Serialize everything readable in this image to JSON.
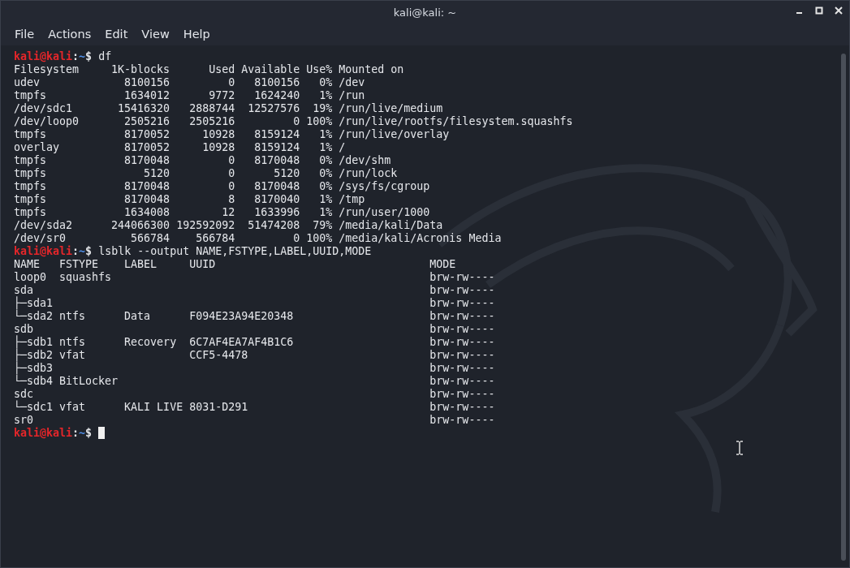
{
  "window": {
    "title": "kali@kali: ~"
  },
  "menu": [
    "File",
    "Actions",
    "Edit",
    "View",
    "Help"
  ],
  "terminal": {
    "lines": [
      {
        "kind": "prompt",
        "user": "kali@kali",
        "separator": ":",
        "path": "~",
        "symbol": "$",
        "command": "df",
        "cursor": false
      },
      {
        "kind": "output",
        "text": "Filesystem     1K-blocks      Used Available Use% Mounted on"
      },
      {
        "kind": "output",
        "text": "udev             8100156         0   8100156   0% /dev"
      },
      {
        "kind": "output",
        "text": "tmpfs            1634012      9772   1624240   1% /run"
      },
      {
        "kind": "output",
        "text": "/dev/sdc1       15416320   2888744  12527576  19% /run/live/medium"
      },
      {
        "kind": "output",
        "text": "/dev/loop0       2505216   2505216         0 100% /run/live/rootfs/filesystem.squashfs"
      },
      {
        "kind": "output",
        "text": "tmpfs            8170052     10928   8159124   1% /run/live/overlay"
      },
      {
        "kind": "output",
        "text": "overlay          8170052     10928   8159124   1% /"
      },
      {
        "kind": "output",
        "text": "tmpfs            8170048         0   8170048   0% /dev/shm"
      },
      {
        "kind": "output",
        "text": "tmpfs               5120         0      5120   0% /run/lock"
      },
      {
        "kind": "output",
        "text": "tmpfs            8170048         0   8170048   0% /sys/fs/cgroup"
      },
      {
        "kind": "output",
        "text": "tmpfs            8170048         8   8170040   1% /tmp"
      },
      {
        "kind": "output",
        "text": "tmpfs            1634008        12   1633996   1% /run/user/1000"
      },
      {
        "kind": "output",
        "text": "/dev/sda2      244066300 192592092  51474208  79% /media/kali/Data"
      },
      {
        "kind": "output",
        "text": "/dev/sr0          566784    566784         0 100% /media/kali/Acronis Media"
      },
      {
        "kind": "prompt",
        "user": "kali@kali",
        "separator": ":",
        "path": "~",
        "symbol": "$",
        "command": "lsblk --output NAME,FSTYPE,LABEL,UUID,MODE",
        "cursor": false
      },
      {
        "kind": "output",
        "text": "NAME   FSTYPE    LABEL     UUID                                 MODE"
      },
      {
        "kind": "output",
        "text": "loop0  squashfs                                                 brw-rw----"
      },
      {
        "kind": "output",
        "text": "sda                                                             brw-rw----"
      },
      {
        "kind": "output",
        "text": "├─sda1                                                          brw-rw----"
      },
      {
        "kind": "output",
        "text": "└─sda2 ntfs      Data      F094E23A94E20348                     brw-rw----"
      },
      {
        "kind": "output",
        "text": "sdb                                                             brw-rw----"
      },
      {
        "kind": "output",
        "text": "├─sdb1 ntfs      Recovery  6C7AF4EA7AF4B1C6                     brw-rw----"
      },
      {
        "kind": "output",
        "text": "├─sdb2 vfat                CCF5-4478                            brw-rw----"
      },
      {
        "kind": "output",
        "text": "├─sdb3                                                          brw-rw----"
      },
      {
        "kind": "output",
        "text": "└─sdb4 BitLocker                                                brw-rw----"
      },
      {
        "kind": "output",
        "text": "sdc                                                             brw-rw----"
      },
      {
        "kind": "output",
        "text": "└─sdc1 vfat      KALI LIVE 8031-D291                            brw-rw----"
      },
      {
        "kind": "output",
        "text": "sr0                                                             brw-rw----"
      },
      {
        "kind": "prompt",
        "user": "kali@kali",
        "separator": ":",
        "path": "~",
        "symbol": "$",
        "cursor": true
      }
    ]
  }
}
